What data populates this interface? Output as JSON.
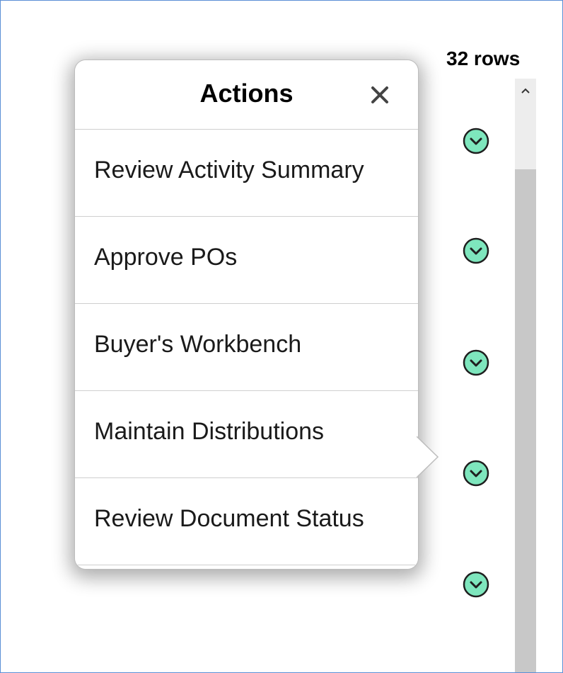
{
  "grid": {
    "rows_count": "32 rows"
  },
  "row_action_buttons": [
    {
      "icon": "chevron-down-circle-icon"
    },
    {
      "icon": "chevron-down-circle-icon"
    },
    {
      "icon": "chevron-down-circle-icon"
    },
    {
      "icon": "chevron-down-circle-icon"
    },
    {
      "icon": "chevron-down-circle-icon"
    }
  ],
  "actions_popup": {
    "title": "Actions",
    "close_icon": "close-icon",
    "items": [
      {
        "label": "Review Activity Summary"
      },
      {
        "label": "Approve POs"
      },
      {
        "label": "Buyer's Workbench"
      },
      {
        "label": "Maintain Distributions"
      },
      {
        "label": "Review Document Status"
      }
    ]
  },
  "colors": {
    "frame_border": "#5b8fd6",
    "button_fill": "#7ee6bd",
    "scrollbar": "#c8c8c8"
  }
}
